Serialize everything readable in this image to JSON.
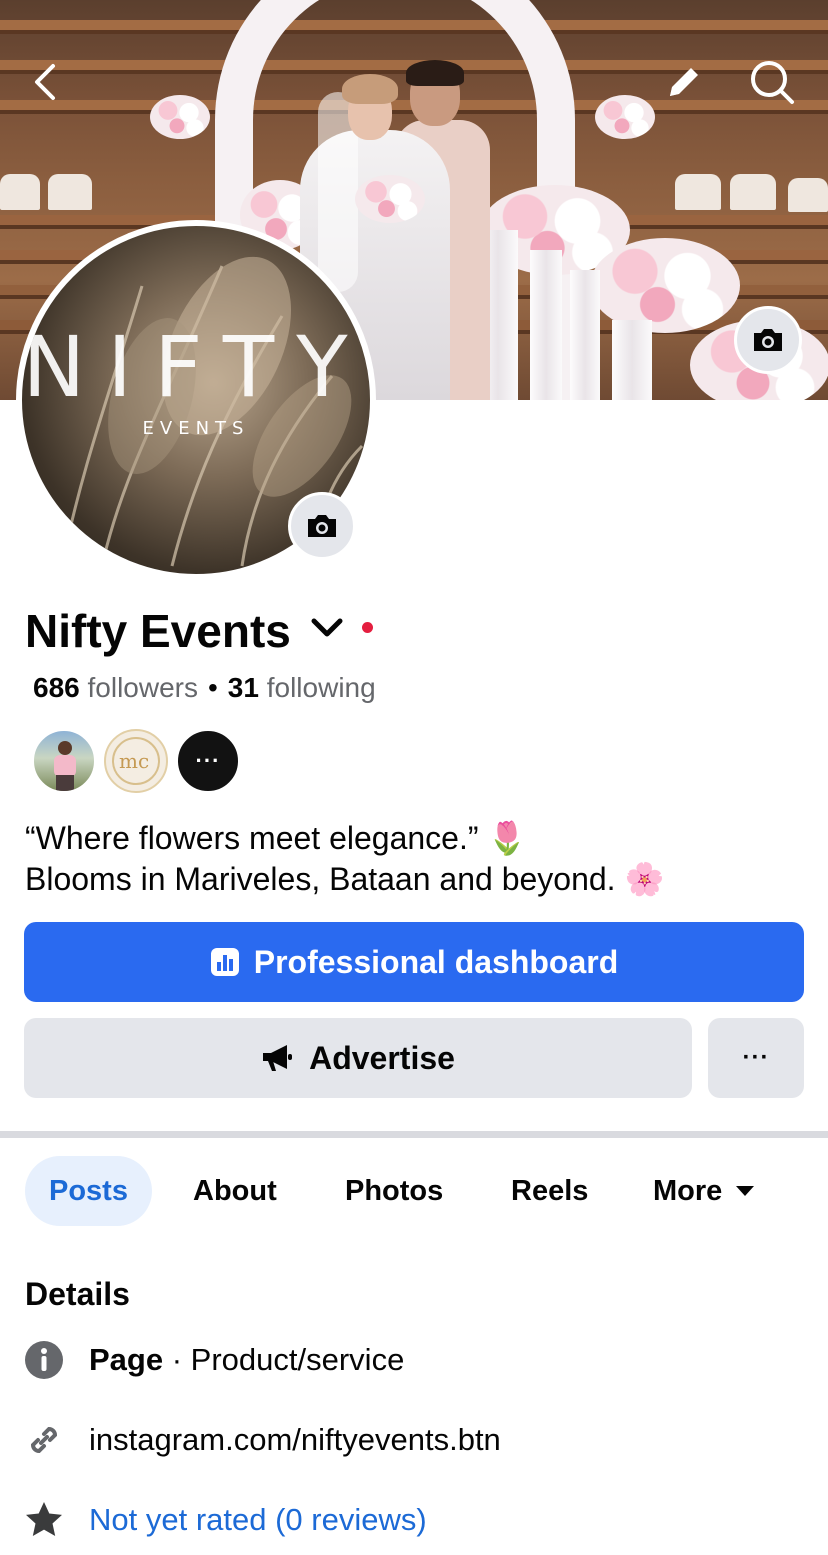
{
  "page": {
    "name": "Nifty Events",
    "followers_count": "686",
    "followers_label": "followers",
    "separator": "•",
    "following_count": "31",
    "following_label": "following",
    "bio_line1": "“Where flowers meet elegance.” 🌷",
    "bio_line2": "Blooms in Mariveles, Bataan and beyond. 🌸"
  },
  "avatar_logo": {
    "big": "NIFTY",
    "small": "EVENTS"
  },
  "buttons": {
    "dashboard_label": "Professional dashboard",
    "advertise_label": "Advertise",
    "more_label": "···"
  },
  "tabs": [
    {
      "label": "Posts",
      "active": true
    },
    {
      "label": "About"
    },
    {
      "label": "Photos"
    },
    {
      "label": "Reels"
    },
    {
      "label": "More"
    }
  ],
  "details": {
    "title": "Details",
    "category_type": "Page",
    "category_sep": " · ",
    "category_value": "Product/service",
    "link": "instagram.com/niftyevents.btn",
    "rating": "Not yet rated (0 reviews)"
  },
  "friends_more_label": "···",
  "colors": {
    "primary": "#2a6af0",
    "link": "#1c6ad6",
    "grey_button": "#e4e6eb",
    "notification_dot": "#e41e3f"
  },
  "icons": [
    "back-icon",
    "edit-pencil-icon",
    "search-icon",
    "camera-icon",
    "chevron-down-icon",
    "dashboard-chart-icon",
    "megaphone-icon",
    "info-icon",
    "link-icon",
    "star-icon",
    "caret-down-icon"
  ]
}
